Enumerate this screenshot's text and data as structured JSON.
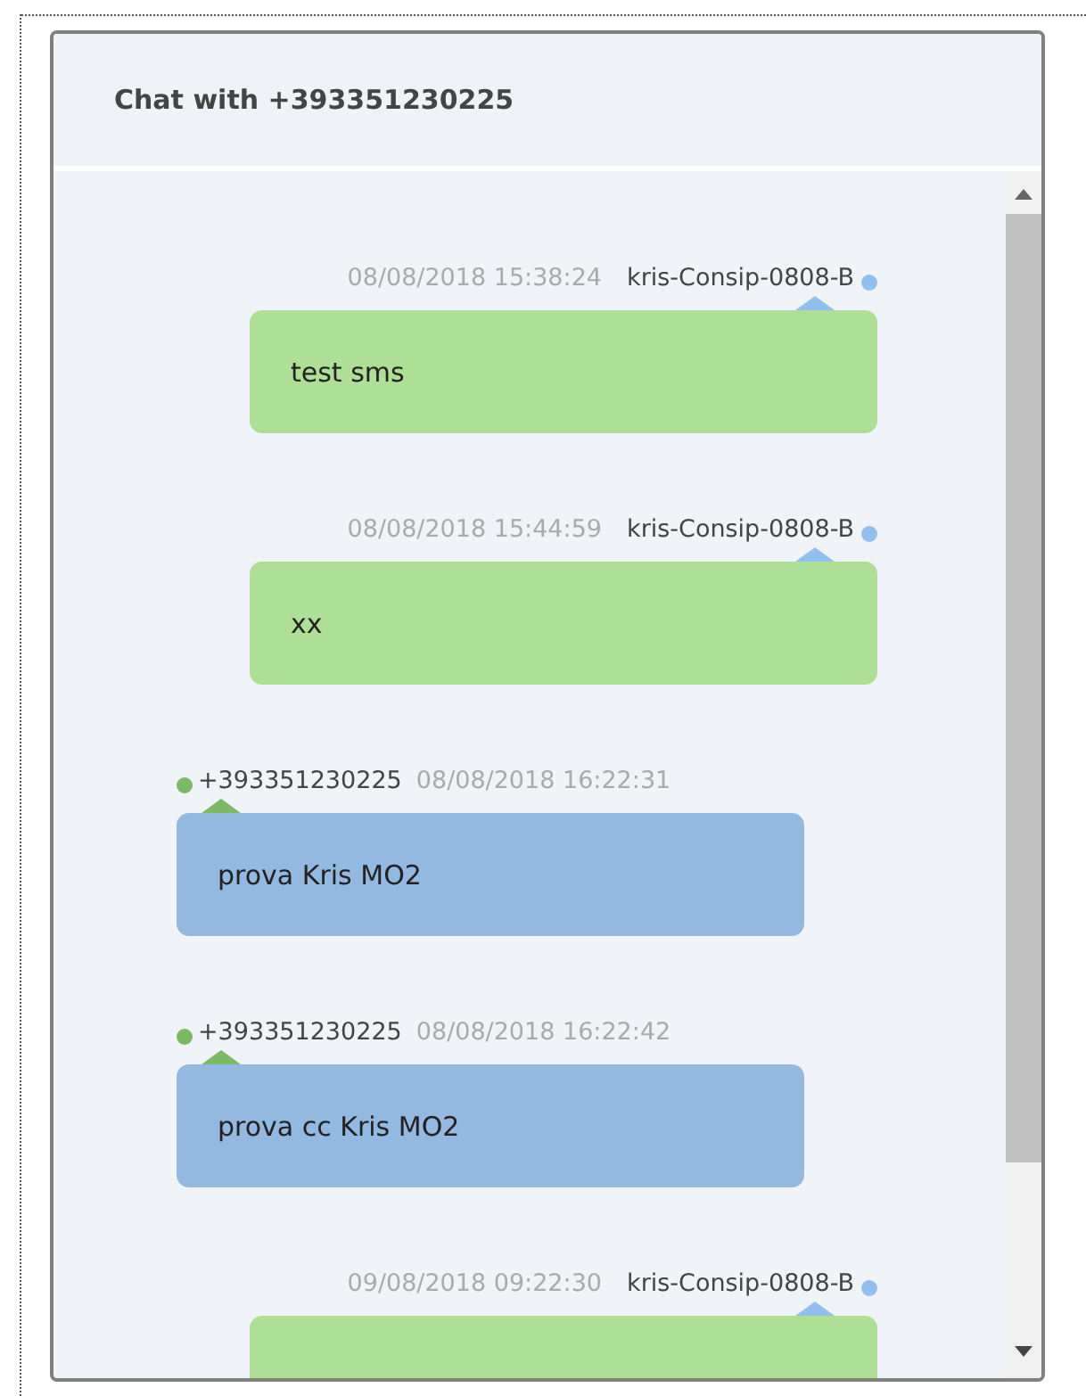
{
  "chat": {
    "title": "Chat with +393351230225"
  },
  "messages": [
    {
      "kind": "sent",
      "sender": "kris-Consip-0808-B",
      "time": "08/08/2018 15:38:24",
      "text": "test sms"
    },
    {
      "kind": "sent",
      "sender": "kris-Consip-0808-B",
      "time": "08/08/2018 15:44:59",
      "text": "xx"
    },
    {
      "kind": "received",
      "sender": "+393351230225",
      "time": "08/08/2018 16:22:31",
      "text": "prova Kris MO2"
    },
    {
      "kind": "received",
      "sender": "+393351230225",
      "time": "08/08/2018 16:22:42",
      "text": "prova cc Kris MO2"
    },
    {
      "kind": "sent",
      "sender": "kris-Consip-0808-B",
      "time": "09/08/2018 09:22:30"
    }
  ]
}
